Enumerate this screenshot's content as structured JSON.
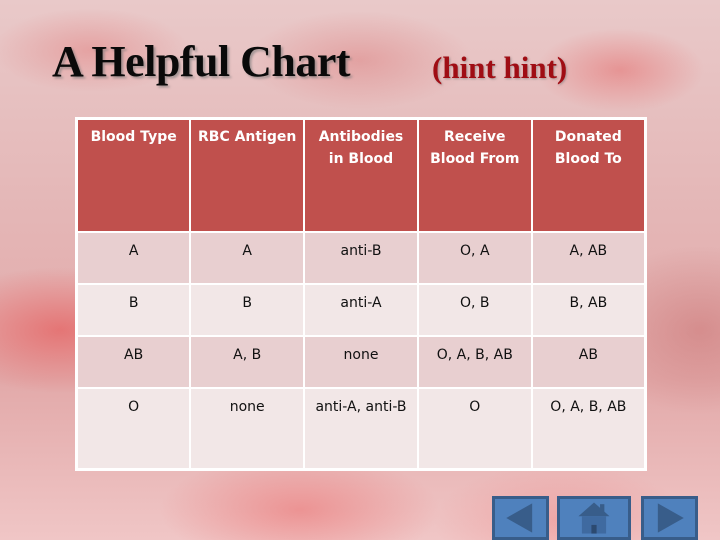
{
  "header": {
    "title": "A Helpful Chart",
    "subtitle": "(hint hint)"
  },
  "table": {
    "columns": [
      "Blood Type",
      "RBC Antigen",
      "Antibodies in Blood",
      "Receive Blood From",
      "Donated Blood To"
    ],
    "rows": [
      [
        "A",
        "A",
        "anti-B",
        "O, A",
        "A, AB"
      ],
      [
        "B",
        "B",
        "anti-A",
        "O, B",
        "B, AB"
      ],
      [
        "AB",
        "A, B",
        "none",
        "O, A, B, AB",
        "AB"
      ],
      [
        "O",
        "none",
        "anti-A, anti-B",
        "O",
        "O, A, B, AB"
      ]
    ]
  },
  "nav": {
    "buttons": [
      {
        "name": "previous",
        "icon": "triangle-left-icon"
      },
      {
        "name": "home",
        "icon": "house-icon"
      },
      {
        "name": "next",
        "icon": "triangle-right-icon"
      }
    ]
  },
  "colors": {
    "header_fill": "#c0504d",
    "row_odd": "#e8cfd0",
    "row_even": "#f2e7e7",
    "subtitle": "#a00d14",
    "nav_button": "#4f81bd"
  }
}
